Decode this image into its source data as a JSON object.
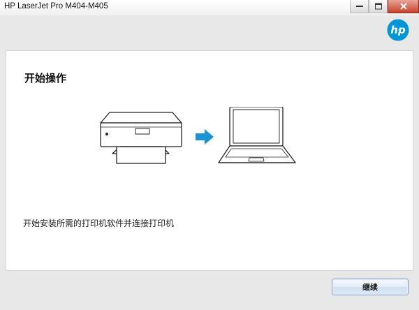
{
  "window": {
    "title": "HP LaserJet Pro M404-M405"
  },
  "brand": {
    "logo_text": "hp",
    "accent_color": "#0096d6"
  },
  "main": {
    "heading": "开始操作",
    "description": "开始安装所需的打印机软件并连接打印机",
    "illustration": {
      "icons": [
        "printer-icon",
        "arrow-right-icon",
        "laptop-icon"
      ]
    }
  },
  "footer": {
    "continue_label": "继续"
  }
}
